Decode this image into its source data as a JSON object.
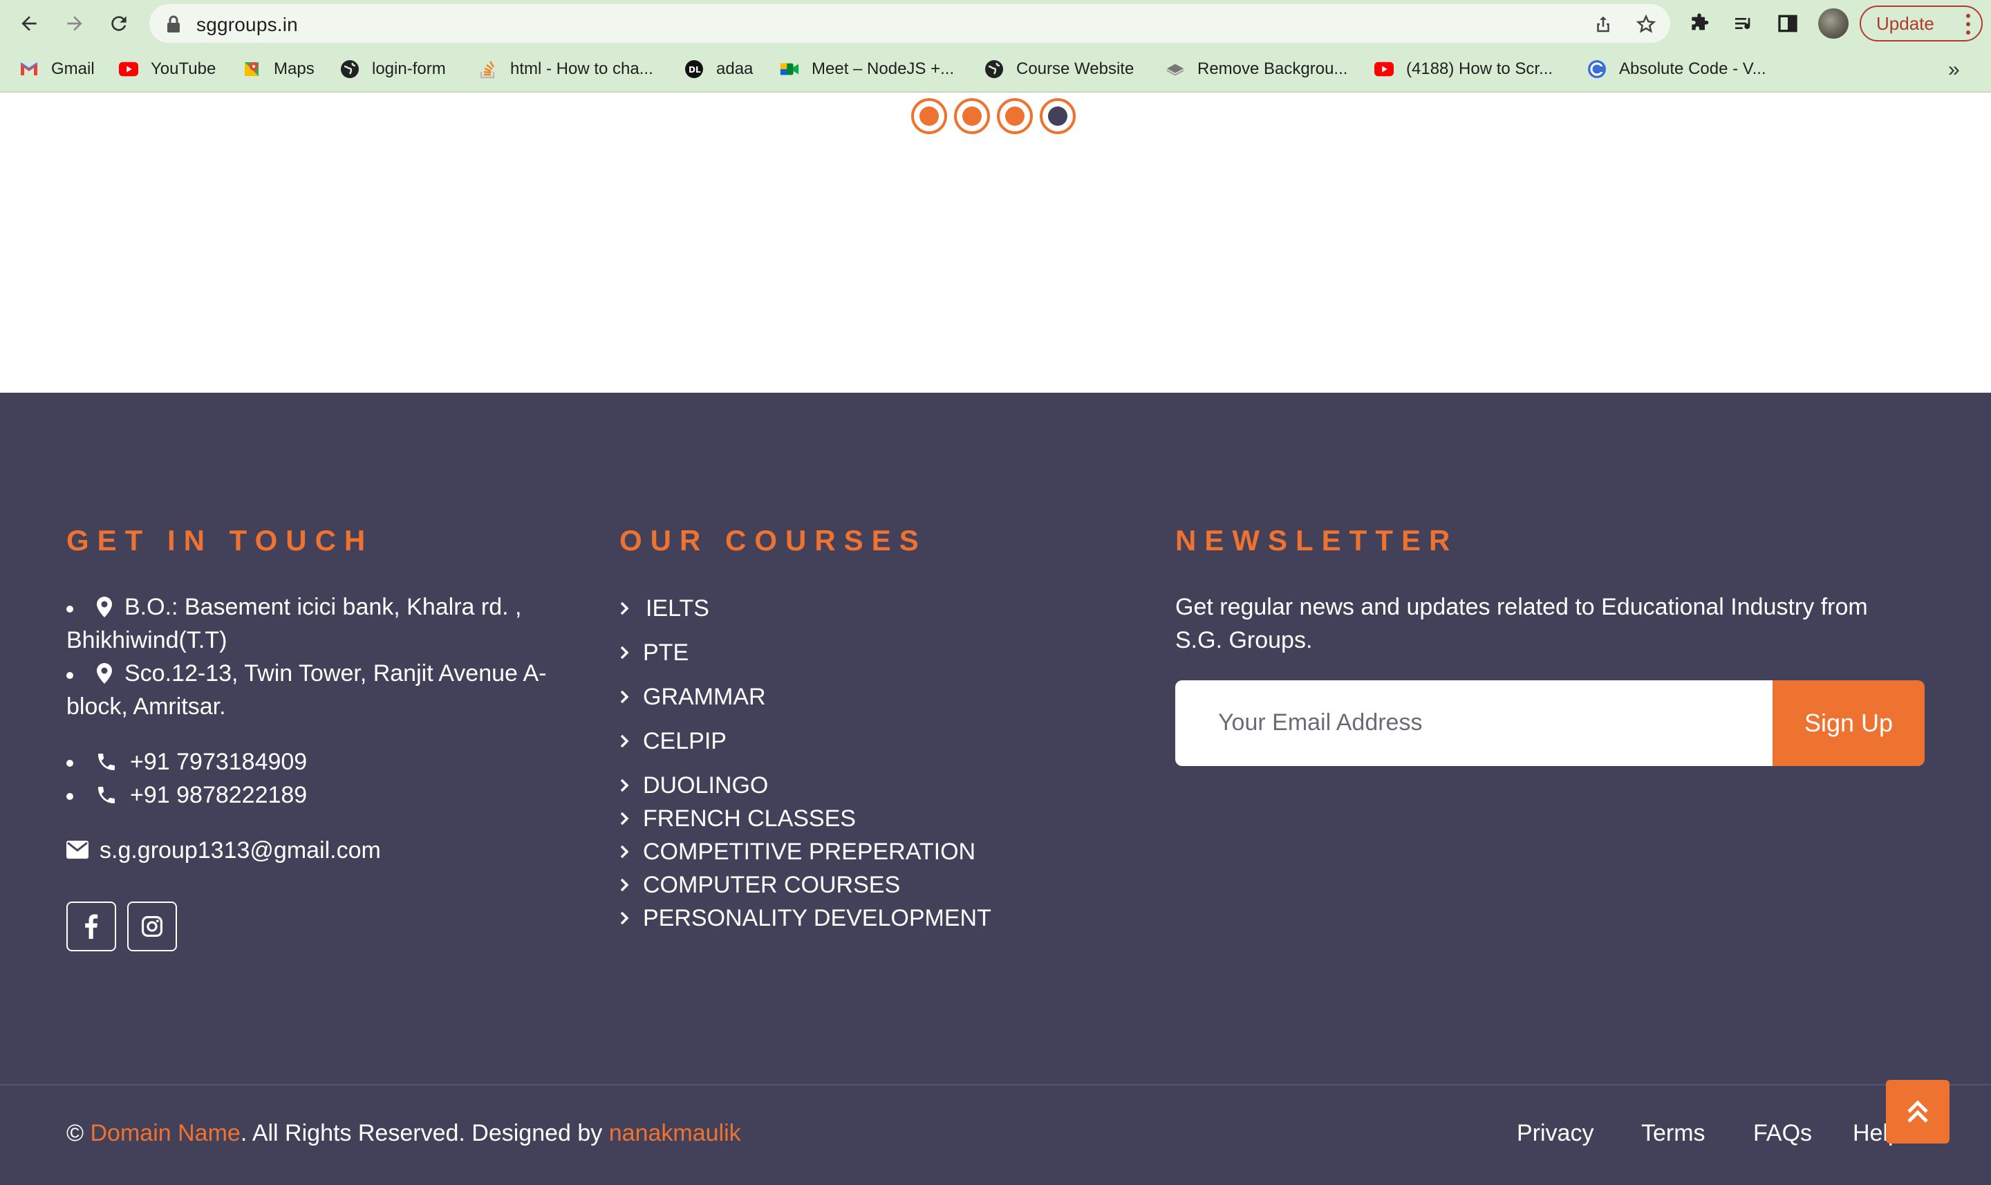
{
  "browser": {
    "url": "sggroups.in",
    "update_label": "Update",
    "bookmarks": [
      {
        "label": "Gmail",
        "icon": "gmail-icon"
      },
      {
        "label": "YouTube",
        "icon": "youtube-icon"
      },
      {
        "label": "Maps",
        "icon": "maps-icon"
      },
      {
        "label": "login-form",
        "icon": "globe-icon"
      },
      {
        "label": "html - How to cha...",
        "icon": "stackoverflow-icon"
      },
      {
        "label": "adaa",
        "icon": "dl-icon"
      },
      {
        "label": "Meet – NodeJS +...",
        "icon": "meet-icon"
      },
      {
        "label": "Course Website",
        "icon": "globe-icon"
      },
      {
        "label": "Remove Backgrou...",
        "icon": "layers-icon"
      },
      {
        "label": "(4188) How to Scr...",
        "icon": "youtube-icon"
      },
      {
        "label": "Absolute Code - V...",
        "icon": "ac-icon"
      }
    ],
    "bookmarks_more": "»"
  },
  "carousel": {
    "count": 4,
    "active_index": 3
  },
  "footer": {
    "contact": {
      "title": "GET IN TOUCH",
      "address1_line1": "B.O.: Basement icici bank, Khalra rd. ,",
      "address1_line2": "Bhikhiwind(T.T)",
      "address2_line1": "Sco.12-13, Twin Tower, Ranjit Avenue A-",
      "address2_line2": "block, Amritsar.",
      "phone1": "+91 7973184909",
      "phone2": "+91 9878222189",
      "email": "s.g.group1313@gmail.com"
    },
    "courses": {
      "title": "OUR COURSES",
      "items": [
        "IELTS",
        "PTE",
        "GRAMMAR",
        "CELPIP",
        "DUOLINGO",
        "FRENCH CLASSES",
        "COMPETITIVE PREPERATION",
        "COMPUTER COURSES",
        "PERSONALITY DEVELOPMENT"
      ]
    },
    "newsletter": {
      "title": "NEWSLETTER",
      "text_line1": "Get regular news and updates related to Educational Industry from",
      "text_line2": "S.G. Groups.",
      "email_placeholder": "Your Email Address",
      "signup_label": "Sign Up"
    },
    "bottom": {
      "copyright_prefix": "© ",
      "domain_name": "Domain Name",
      "copyright_middle": ". All Rights Reserved. Designed by ",
      "designer": "nanakmaulik",
      "links": [
        "Privacy",
        "Terms",
        "FAQs",
        "Help"
      ]
    }
  },
  "colors": {
    "accent": "#ee7230",
    "footer_bg": "#43415a",
    "chrome_bg": "#d8ebd3",
    "update_red": "#b03a2e"
  }
}
